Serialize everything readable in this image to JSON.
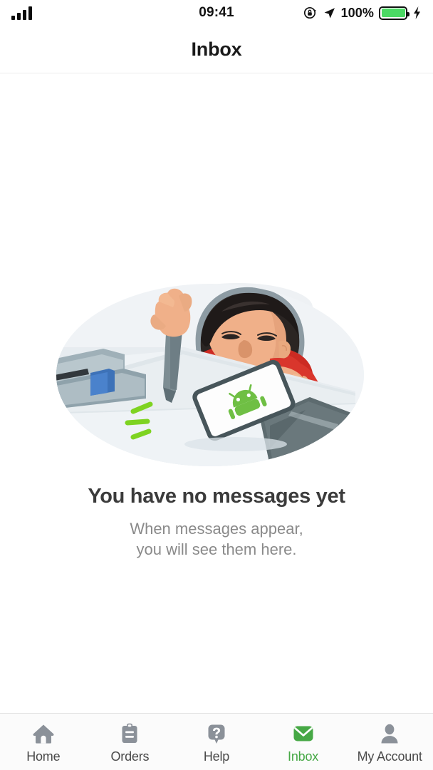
{
  "status_bar": {
    "signal_icon": "signal-bars-icon",
    "signal_bars": 4,
    "time": "09:41",
    "rotation_lock_icon": "rotation-lock-icon",
    "location_icon": "location-arrow-icon",
    "battery_percent": "100%",
    "battery_icon": "battery-icon",
    "battery_color": "#4bd964",
    "charging_icon": "lightning-bolt-icon"
  },
  "header": {
    "title": "Inbox"
  },
  "empty_state": {
    "illustration_name": "boy-poking-phone-with-stylus-illustration",
    "title": "You have no messages yet",
    "subtitle_line1": "When messages appear,",
    "subtitle_line2": "you will see them here."
  },
  "tabbar": {
    "active_color": "#46a845",
    "inactive_color": "#4a4a4a",
    "items": [
      {
        "id": "home",
        "label": "Home",
        "icon": "home-icon",
        "active": false
      },
      {
        "id": "orders",
        "label": "Orders",
        "icon": "clipboard-icon",
        "active": false
      },
      {
        "id": "help",
        "label": "Help",
        "icon": "question-bubble-icon",
        "active": false
      },
      {
        "id": "inbox",
        "label": "Inbox",
        "icon": "envelope-icon",
        "active": true
      },
      {
        "id": "account",
        "label": "My Account",
        "icon": "person-icon",
        "active": false
      }
    ]
  }
}
